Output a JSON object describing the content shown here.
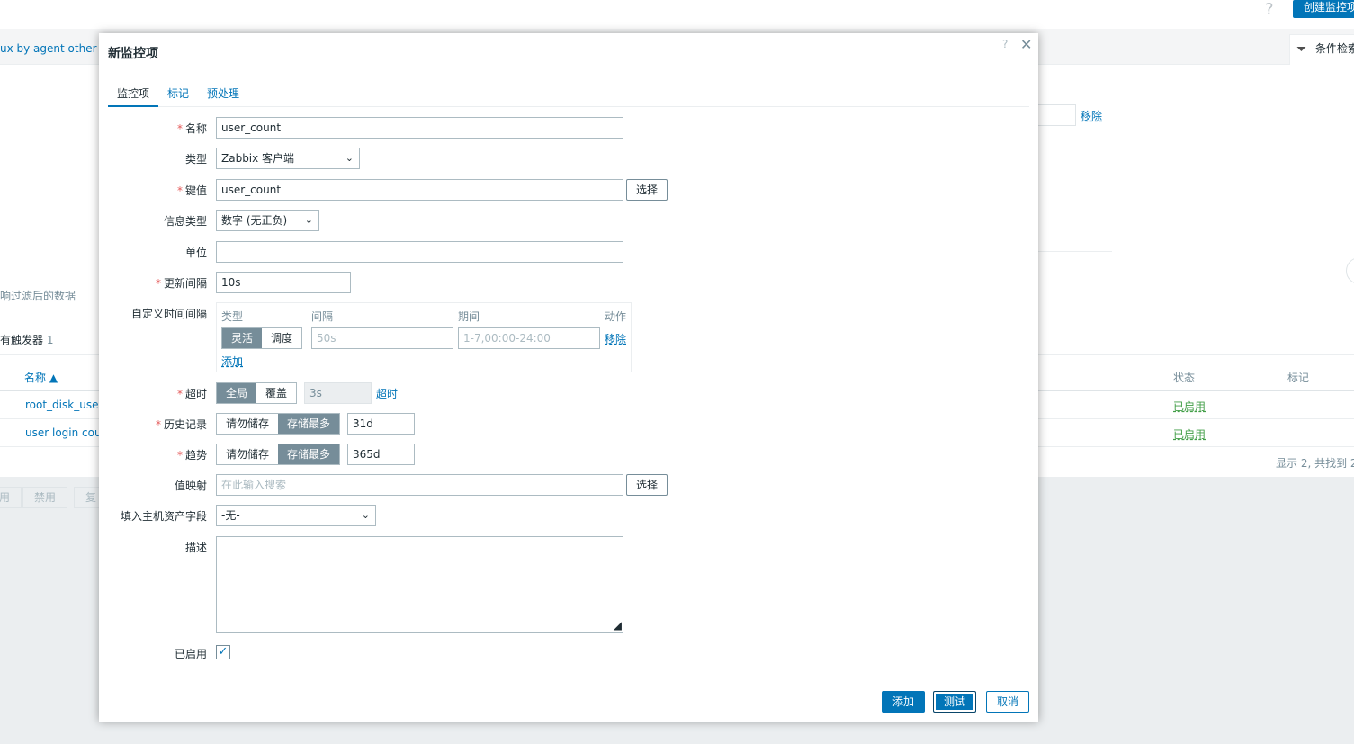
{
  "background": {
    "help_icon": "?",
    "create_button": "创建监控项",
    "template_link": "ux by agent other",
    "filter_tab": "条件检索",
    "filter_remove": "移除",
    "notice": "响过滤后的数据",
    "triggers_label": "有触发器",
    "triggers_count": "1",
    "table": {
      "col_name": "名称 ▲",
      "col_status": "状态",
      "col_tags": "标记",
      "rows": [
        {
          "name": "root_disk_use",
          "status": "已启用"
        },
        {
          "name": "user login coun",
          "status": "已启用"
        }
      ],
      "footer": "显示 2, 共找到 2"
    },
    "buttons": [
      "用",
      "禁用",
      "复"
    ]
  },
  "dialog": {
    "title": "新监控项",
    "help": "?",
    "close": "✕",
    "tabs": [
      {
        "label": "监控项"
      },
      {
        "label": "标记"
      },
      {
        "label": "预处理"
      }
    ],
    "fields": {
      "name_label": "名称",
      "name_value": "user_count",
      "type_label": "类型",
      "type_value": "Zabbix 客户端",
      "key_label": "键值",
      "key_value": "user_count",
      "key_select": "选择",
      "info_type_label": "信息类型",
      "info_type_value": "数字 (无正负)",
      "units_label": "单位",
      "units_value": "",
      "interval_label": "更新间隔",
      "interval_value": "10s",
      "custom_label": "自定义时间间隔",
      "custom": {
        "h_type": "类型",
        "h_interval": "间隔",
        "h_period": "期间",
        "h_action": "动作",
        "flexible": "灵活",
        "scheduling": "调度",
        "interval_placeholder": "50s",
        "period_placeholder": "1-7,00:00-24:00",
        "remove": "移除",
        "add": "添加"
      },
      "timeout_label": "超时",
      "timeout_global": "全局",
      "timeout_override": "覆盖",
      "timeout_value": "3s",
      "timeout_link": "超时",
      "history_label": "历史记录",
      "history_no": "请勿储存",
      "history_store": "存储最多",
      "history_value": "31d",
      "trends_label": "趋势",
      "trends_no": "请勿储存",
      "trends_store": "存储最多",
      "trends_value": "365d",
      "valuemap_label": "值映射",
      "valuemap_placeholder": "在此输入搜索",
      "valuemap_select": "选择",
      "inventory_label": "填入主机资产字段",
      "inventory_value": "-无-",
      "description_label": "描述",
      "enabled_label": "已启用",
      "enabled": true
    },
    "footer": {
      "add": "添加",
      "test": "测试",
      "cancel": "取消"
    }
  }
}
